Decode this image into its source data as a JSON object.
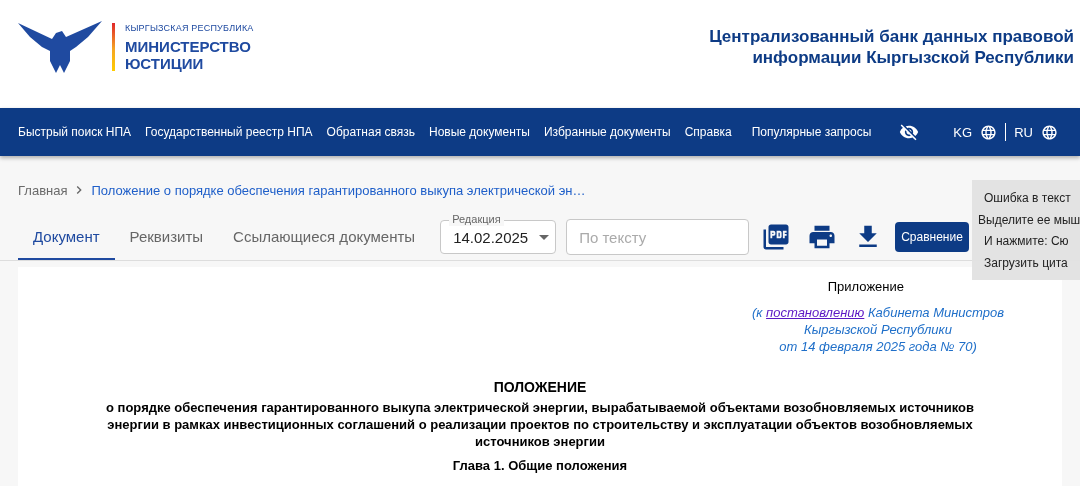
{
  "header": {
    "logo": {
      "country": "КЫРГЫЗСКАЯ РЕСПУБЛИКА",
      "ministry_lines": [
        "МИНИСТЕРСТВО",
        "ЮСТИЦИИ"
      ]
    },
    "site_title": [
      "Централизованный банк данных правовой",
      "информации Кыргызской Республики"
    ]
  },
  "nav": {
    "items": [
      "Быстрый поиск НПА",
      "Государственный реестр НПА",
      "Обратная связь",
      "Новые документы",
      "Избранные документы",
      "Справка",
      "Популярные запросы"
    ],
    "languages": [
      {
        "code": "KG"
      },
      {
        "code": "RU"
      }
    ]
  },
  "breadcrumb": [
    "Главная",
    "Положение о порядке обеспечения гарантированного выкупа электрической эн…"
  ],
  "tabs": [
    {
      "label": "Документ",
      "selected": true
    },
    {
      "label": "Реквизиты",
      "selected": false
    },
    {
      "label": "Ссылающиеся документы",
      "selected": false
    }
  ],
  "edition": {
    "label": "Редакция",
    "value": "14.02.2025"
  },
  "search": {
    "placeholder": "По тексту"
  },
  "compare_button": "Сравнение",
  "popup": [
    "Ошибка в текст",
    "Выделите ее мыш",
    "И нажмите: Сю",
    "Загрузить цита"
  ],
  "document": {
    "appendix_label": "Приложение",
    "reference": {
      "prefix": "(к ",
      "link": "постановлению",
      "lines": [
        "Кабинета Министров",
        "Кыргызской Республики",
        "от 14 февраля 2025 года № 70)"
      ]
    },
    "title": "ПОЛОЖЕНИЕ",
    "subtitle": "о порядке обеспечения гарантированного выкупа электрической энергии, вырабатываемой объектами возобновляемых источников энергии в рамках инвестиционных соглашений о реализации проектов по строительству и эксплуатации объектов возобновляемых источников энергии",
    "chapter": "Глава 1. Общие положения"
  }
}
